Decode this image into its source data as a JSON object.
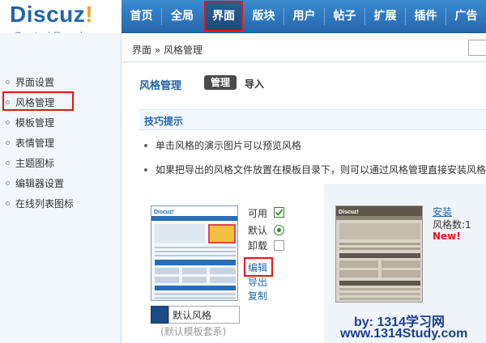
{
  "logo": {
    "brand": "Discuz",
    "bang": "!",
    "sub": "Control Panel"
  },
  "topnav": [
    {
      "label": "首页",
      "active": false
    },
    {
      "label": "全局",
      "active": false
    },
    {
      "label": "界面",
      "active": true
    },
    {
      "label": "版块",
      "active": false
    },
    {
      "label": "用户",
      "active": false
    },
    {
      "label": "帖子",
      "active": false
    },
    {
      "label": "扩展",
      "active": false
    },
    {
      "label": "插件",
      "active": false
    },
    {
      "label": "广告",
      "active": false
    }
  ],
  "breadcrumb": "界面 » 风格管理",
  "sidebar": [
    {
      "label": "界面设置"
    },
    {
      "label": "风格管理",
      "selected": true
    },
    {
      "label": "模板管理"
    },
    {
      "label": "表情管理"
    },
    {
      "label": "主题图标"
    },
    {
      "label": "编辑器设置"
    },
    {
      "label": "在线列表图标"
    }
  ],
  "page": {
    "title": "风格管理",
    "tab_manage": "管理",
    "tab_import": "导入",
    "tips_title": "技巧提示",
    "tips": [
      "单击风格的演示图片可以预览风格",
      "如果把导出的风格文件放置在模板目录下，则可以通过风格管理直接安装风格"
    ]
  },
  "style1": {
    "enable_label": "可用",
    "enable_checked": true,
    "default_label": "默认",
    "default_selected": true,
    "uninstall_label": "卸载",
    "uninstall_checked": false,
    "edit_link": "编辑",
    "export_link": "导出",
    "copy_link": "复制",
    "name_value": "默认风格",
    "note": "(默认模板套系)",
    "swatch_color": "#1b4c85"
  },
  "style2": {
    "install_link": "安装",
    "count_text": "风格数:1",
    "new_badge": "New!"
  },
  "watermark": {
    "line1": "by: 1314学习网",
    "line2": "www.1314Study.com"
  }
}
